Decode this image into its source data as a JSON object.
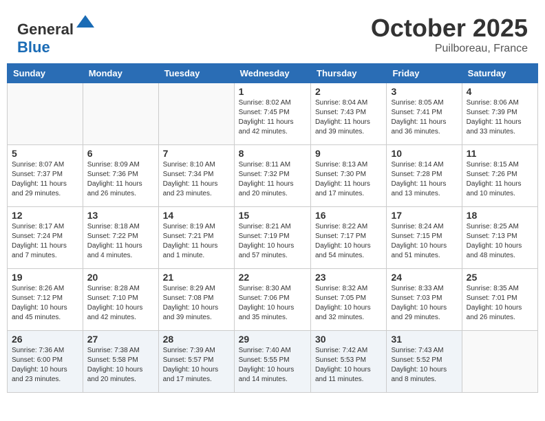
{
  "header": {
    "logo_general": "General",
    "logo_blue": "Blue",
    "month": "October 2025",
    "location": "Puilboreau, France"
  },
  "weekdays": [
    "Sunday",
    "Monday",
    "Tuesday",
    "Wednesday",
    "Thursday",
    "Friday",
    "Saturday"
  ],
  "weeks": [
    [
      {
        "day": "",
        "info": ""
      },
      {
        "day": "",
        "info": ""
      },
      {
        "day": "",
        "info": ""
      },
      {
        "day": "1",
        "info": "Sunrise: 8:02 AM\nSunset: 7:45 PM\nDaylight: 11 hours\nand 42 minutes."
      },
      {
        "day": "2",
        "info": "Sunrise: 8:04 AM\nSunset: 7:43 PM\nDaylight: 11 hours\nand 39 minutes."
      },
      {
        "day": "3",
        "info": "Sunrise: 8:05 AM\nSunset: 7:41 PM\nDaylight: 11 hours\nand 36 minutes."
      },
      {
        "day": "4",
        "info": "Sunrise: 8:06 AM\nSunset: 7:39 PM\nDaylight: 11 hours\nand 33 minutes."
      }
    ],
    [
      {
        "day": "5",
        "info": "Sunrise: 8:07 AM\nSunset: 7:37 PM\nDaylight: 11 hours\nand 29 minutes."
      },
      {
        "day": "6",
        "info": "Sunrise: 8:09 AM\nSunset: 7:36 PM\nDaylight: 11 hours\nand 26 minutes."
      },
      {
        "day": "7",
        "info": "Sunrise: 8:10 AM\nSunset: 7:34 PM\nDaylight: 11 hours\nand 23 minutes."
      },
      {
        "day": "8",
        "info": "Sunrise: 8:11 AM\nSunset: 7:32 PM\nDaylight: 11 hours\nand 20 minutes."
      },
      {
        "day": "9",
        "info": "Sunrise: 8:13 AM\nSunset: 7:30 PM\nDaylight: 11 hours\nand 17 minutes."
      },
      {
        "day": "10",
        "info": "Sunrise: 8:14 AM\nSunset: 7:28 PM\nDaylight: 11 hours\nand 13 minutes."
      },
      {
        "day": "11",
        "info": "Sunrise: 8:15 AM\nSunset: 7:26 PM\nDaylight: 11 hours\nand 10 minutes."
      }
    ],
    [
      {
        "day": "12",
        "info": "Sunrise: 8:17 AM\nSunset: 7:24 PM\nDaylight: 11 hours\nand 7 minutes."
      },
      {
        "day": "13",
        "info": "Sunrise: 8:18 AM\nSunset: 7:22 PM\nDaylight: 11 hours\nand 4 minutes."
      },
      {
        "day": "14",
        "info": "Sunrise: 8:19 AM\nSunset: 7:21 PM\nDaylight: 11 hours\nand 1 minute."
      },
      {
        "day": "15",
        "info": "Sunrise: 8:21 AM\nSunset: 7:19 PM\nDaylight: 10 hours\nand 57 minutes."
      },
      {
        "day": "16",
        "info": "Sunrise: 8:22 AM\nSunset: 7:17 PM\nDaylight: 10 hours\nand 54 minutes."
      },
      {
        "day": "17",
        "info": "Sunrise: 8:24 AM\nSunset: 7:15 PM\nDaylight: 10 hours\nand 51 minutes."
      },
      {
        "day": "18",
        "info": "Sunrise: 8:25 AM\nSunset: 7:13 PM\nDaylight: 10 hours\nand 48 minutes."
      }
    ],
    [
      {
        "day": "19",
        "info": "Sunrise: 8:26 AM\nSunset: 7:12 PM\nDaylight: 10 hours\nand 45 minutes."
      },
      {
        "day": "20",
        "info": "Sunrise: 8:28 AM\nSunset: 7:10 PM\nDaylight: 10 hours\nand 42 minutes."
      },
      {
        "day": "21",
        "info": "Sunrise: 8:29 AM\nSunset: 7:08 PM\nDaylight: 10 hours\nand 39 minutes."
      },
      {
        "day": "22",
        "info": "Sunrise: 8:30 AM\nSunset: 7:06 PM\nDaylight: 10 hours\nand 35 minutes."
      },
      {
        "day": "23",
        "info": "Sunrise: 8:32 AM\nSunset: 7:05 PM\nDaylight: 10 hours\nand 32 minutes."
      },
      {
        "day": "24",
        "info": "Sunrise: 8:33 AM\nSunset: 7:03 PM\nDaylight: 10 hours\nand 29 minutes."
      },
      {
        "day": "25",
        "info": "Sunrise: 8:35 AM\nSunset: 7:01 PM\nDaylight: 10 hours\nand 26 minutes."
      }
    ],
    [
      {
        "day": "26",
        "info": "Sunrise: 7:36 AM\nSunset: 6:00 PM\nDaylight: 10 hours\nand 23 minutes."
      },
      {
        "day": "27",
        "info": "Sunrise: 7:38 AM\nSunset: 5:58 PM\nDaylight: 10 hours\nand 20 minutes."
      },
      {
        "day": "28",
        "info": "Sunrise: 7:39 AM\nSunset: 5:57 PM\nDaylight: 10 hours\nand 17 minutes."
      },
      {
        "day": "29",
        "info": "Sunrise: 7:40 AM\nSunset: 5:55 PM\nDaylight: 10 hours\nand 14 minutes."
      },
      {
        "day": "30",
        "info": "Sunrise: 7:42 AM\nSunset: 5:53 PM\nDaylight: 10 hours\nand 11 minutes."
      },
      {
        "day": "31",
        "info": "Sunrise: 7:43 AM\nSunset: 5:52 PM\nDaylight: 10 hours\nand 8 minutes."
      },
      {
        "day": "",
        "info": ""
      }
    ]
  ]
}
